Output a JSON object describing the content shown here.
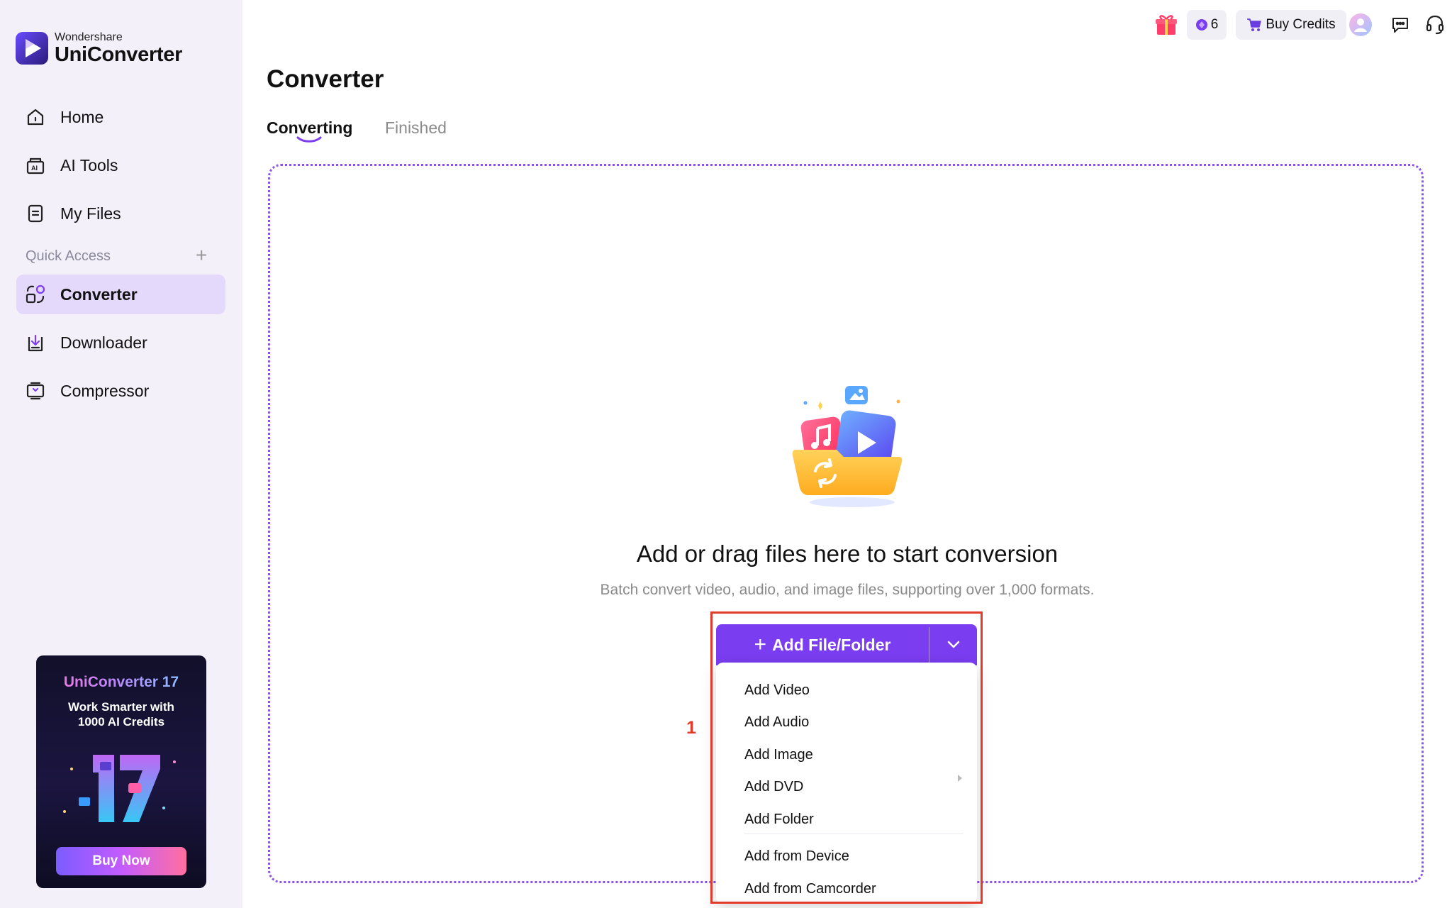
{
  "app": {
    "brand": "Wondershare",
    "product": "UniConverter"
  },
  "colors": {
    "accent": "#7a3df0",
    "annotation": "#e23b2b",
    "sidebar_bg": "#f3f0fa",
    "active_bg": "#e4d9fb"
  },
  "sidebar": {
    "nav": [
      {
        "label": "Home",
        "icon": "home-icon"
      },
      {
        "label": "AI Tools",
        "icon": "ai-tools-icon"
      },
      {
        "label": "My Files",
        "icon": "files-icon"
      }
    ],
    "quick_access_label": "Quick Access",
    "quick_access": [
      {
        "label": "Converter",
        "icon": "converter-icon",
        "active": true
      },
      {
        "label": "Downloader",
        "icon": "downloader-icon"
      },
      {
        "label": "Compressor",
        "icon": "compressor-icon"
      }
    ],
    "promo": {
      "title": "UniConverter 17",
      "line1": "Work Smarter with",
      "line2": "1000 AI Credits",
      "button": "Buy Now"
    }
  },
  "topbar": {
    "credits": "6",
    "buy_credits": "Buy Credits"
  },
  "main": {
    "title": "Converter",
    "tabs": [
      {
        "label": "Converting",
        "active": true
      },
      {
        "label": "Finished",
        "active": false
      }
    ],
    "dropzone": {
      "title": "Add or drag files here to start conversion",
      "subtitle": "Batch convert video, audio, and image files, supporting over 1,000 formats.",
      "add_button": "Add File/Folder"
    },
    "menu": {
      "items": [
        "Add Video",
        "Add Audio",
        "Add Image",
        "Add DVD",
        "Add Folder"
      ],
      "items2": [
        "Add from Device",
        "Add from Camcorder"
      ]
    },
    "annotation_label": "1"
  }
}
